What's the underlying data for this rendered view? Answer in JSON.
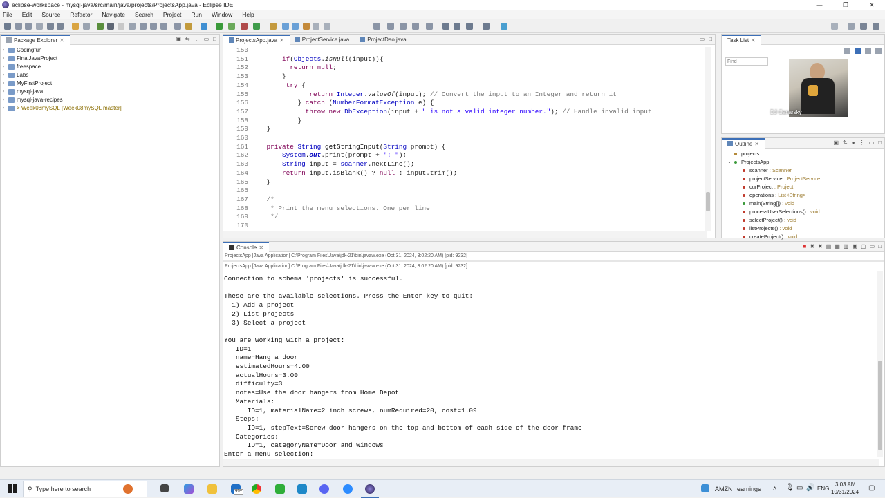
{
  "window": {
    "title": "eclipse-workspace - mysql-java/src/main/java/projects/ProjectsApp.java - Eclipse IDE",
    "min": "—",
    "max": "❐",
    "close": "✕"
  },
  "menu": [
    "File",
    "Edit",
    "Source",
    "Refactor",
    "Navigate",
    "Search",
    "Project",
    "Run",
    "Window",
    "Help"
  ],
  "package_explorer": {
    "title": "Package Explorer",
    "items": [
      {
        "label": "Codingfun",
        "suffix": ""
      },
      {
        "label": "FinalJavaProject",
        "suffix": ""
      },
      {
        "label": "freespace",
        "suffix": ""
      },
      {
        "label": "Labs",
        "suffix": ""
      },
      {
        "label": "MyFirstProject",
        "suffix": ""
      },
      {
        "label": "mysql-java",
        "suffix": ""
      },
      {
        "label": "mysql-java-recipes",
        "suffix": ""
      },
      {
        "label": "> Week08mySQL",
        "suffix": "[Week08mySQL master]"
      }
    ]
  },
  "editor_tabs": [
    "ProjectsApp.java",
    "ProjectService.java",
    "ProjectDao.java"
  ],
  "code_lines": [
    {
      "n": "150",
      "html": ""
    },
    {
      "n": "151",
      "html": "        <span class='kw'>if</span>(<span class='ty'>Objects</span>.<span class='it'>isNull</span>(input)){"
    },
    {
      "n": "152",
      "html": "          <span class='kw'>return</span> <span class='kw'>null</span>;"
    },
    {
      "n": "153",
      "html": "        }"
    },
    {
      "n": "154",
      "html": "         <span class='kw'>try</span> {"
    },
    {
      "n": "155",
      "html": "               <span class='kw'>return</span> <span class='ty'>Integer</span>.<span class='it'>valueOf</span>(input); <span class='cm'>// Convert the input to an Integer and return it</span>"
    },
    {
      "n": "156",
      "html": "            } <span class='kw'>catch</span> (<span class='ty'>NumberFormatException</span> e) {"
    },
    {
      "n": "157",
      "html": "              <span class='kw'>throw</span> <span class='kw'>new</span> <span class='ty'>DbException</span>(input + <span class='str'>\" is not a valid integer number.\"</span>); <span class='cm'>// Handle invalid input</span>"
    },
    {
      "n": "158",
      "html": "            }"
    },
    {
      "n": "159",
      "html": "    }"
    },
    {
      "n": "160",
      "html": ""
    },
    {
      "n": "161",
      "html": "    <span class='kw'>private</span> <span class='ty'>String</span> <span class='mth'>getStringInput</span>(<span class='ty'>String</span> prompt) {"
    },
    {
      "n": "162",
      "html": "        <span class='ty'>System</span>.<span class='fld'>out</span>.print(prompt + <span class='str'>\": \"</span>);"
    },
    {
      "n": "163",
      "html": "        <span class='ty'>String</span> input = <span class='ty'>scanner</span>.nextLine();"
    },
    {
      "n": "164",
      "html": "        <span class='kw'>return</span> input.isBlank() ? <span class='kw'>null</span> : input.trim();"
    },
    {
      "n": "165",
      "html": "    }"
    },
    {
      "n": "166",
      "html": ""
    },
    {
      "n": "167",
      "html": "    <span class='cm'>/*</span>"
    },
    {
      "n": "168",
      "html": "     <span class='cm'>* Print the menu selections. One per line</span>"
    },
    {
      "n": "169",
      "html": "     <span class='cm'>*/</span>"
    },
    {
      "n": "170",
      "html": ""
    }
  ],
  "task_list": {
    "title": "Task List",
    "find_placeholder": "Find"
  },
  "webcam": {
    "name": "DJ Canarsky"
  },
  "outline": {
    "title": "Outline",
    "items": [
      {
        "label": "projects",
        "type": "",
        "indent": 1
      },
      {
        "label": "ProjectsApp",
        "type": "",
        "indent": 1
      },
      {
        "label": "scanner",
        "type": ": Scanner",
        "indent": 2
      },
      {
        "label": "projectService",
        "type": ": ProjectService",
        "indent": 2
      },
      {
        "label": "curProject",
        "type": ": Project",
        "indent": 2
      },
      {
        "label": "operations",
        "type": ": List<String>",
        "indent": 2
      },
      {
        "label": "main(String[])",
        "type": ": void",
        "indent": 2
      },
      {
        "label": "processUserSelections()",
        "type": ": void",
        "indent": 2
      },
      {
        "label": "selectProject()",
        "type": ": void",
        "indent": 2
      },
      {
        "label": "listProjects()",
        "type": ": void",
        "indent": 2
      },
      {
        "label": "createProject()",
        "type": ": void",
        "indent": 2
      }
    ]
  },
  "console": {
    "title": "Console",
    "status1": "ProjectsApp [Java Application] C:\\Program Files\\Java\\jdk-21\\bin\\javaw.exe  (Oct 31, 2024, 3:02:20 AM) [pid: 9232]",
    "status2": "ProjectsApp [Java Application] C:\\Program Files\\Java\\jdk-21\\bin\\javaw.exe  (Oct 31, 2024, 3:02:20 AM) [pid: 9232]",
    "lines": [
      "Connection to schema 'projects' is successful.",
      "",
      "These are the available selections. Press the Enter key to quit:",
      "  1) Add a project",
      "  2) List projects",
      "  3) Select a project",
      "",
      "You are working with a project:",
      "   ID=1",
      "   name=Hang a door",
      "   estimatedHours=4.00",
      "   actualHours=3.00",
      "   difficulty=3",
      "   notes=Use the door hangers from Home Depot",
      "   Materials:",
      "      ID=1, materialName=2 inch screws, numRequired=20, cost=1.09",
      "   Steps:",
      "      ID=1, stepText=Screw door hangers on the top and bottom of each side of the door frame",
      "   Categories:",
      "      ID=1, categoryName=Door and Windows",
      "Enter a menu selection:"
    ]
  },
  "taskbar": {
    "search_placeholder": "Type here to search",
    "stock": "AMZN",
    "stock_label": "earnings",
    "lang": "ENG",
    "time": "3:03 AM",
    "date": "10/31/2024",
    "badge": "99+"
  }
}
